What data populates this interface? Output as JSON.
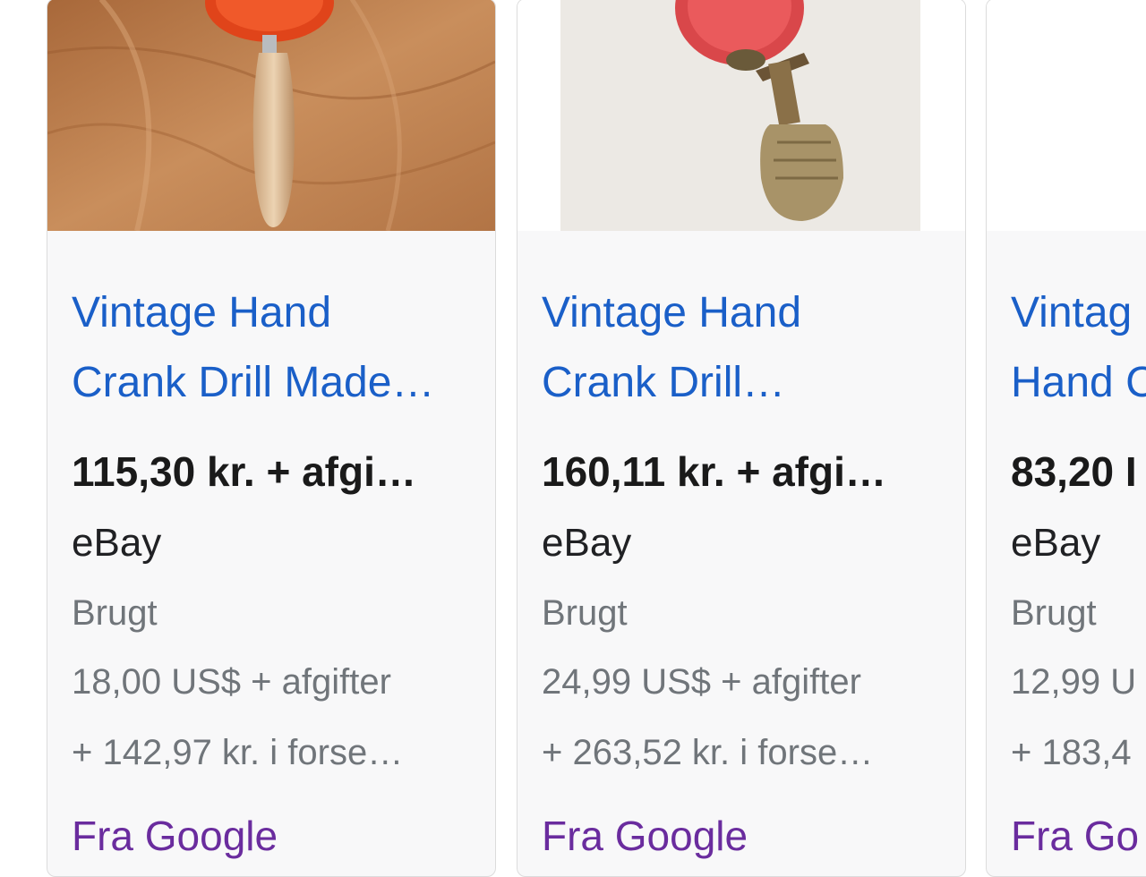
{
  "products": [
    {
      "title_line1": "Vintage Hand",
      "title_line2": "Crank Drill Made…",
      "price": "115,30 kr. + afgi…",
      "merchant": "eBay",
      "condition": "Brugt",
      "original_price": "18,00 US$ + afgifter",
      "shipping": "+ 142,97 kr. i forse…",
      "source": "Fra Google"
    },
    {
      "title_line1": "Vintage Hand",
      "title_line2": "Crank Drill…",
      "price": "160,11 kr. + afgi…",
      "merchant": "eBay",
      "condition": "Brugt",
      "original_price": "24,99 US$ + afgifter",
      "shipping": "+ 263,52 kr. i forse…",
      "source": "Fra Google"
    },
    {
      "title_line1": "Vintag",
      "title_line2": "Hand C",
      "price": "83,20 I",
      "merchant": "eBay",
      "condition": "Brugt",
      "original_price": "12,99 U",
      "shipping": "+ 183,4",
      "source": "Fra Go"
    }
  ],
  "colors": {
    "title_link": "#1a5fc8",
    "source_link": "#6a2c9e",
    "secondary_text": "#70757a",
    "card_bg": "#f8f8f9"
  }
}
